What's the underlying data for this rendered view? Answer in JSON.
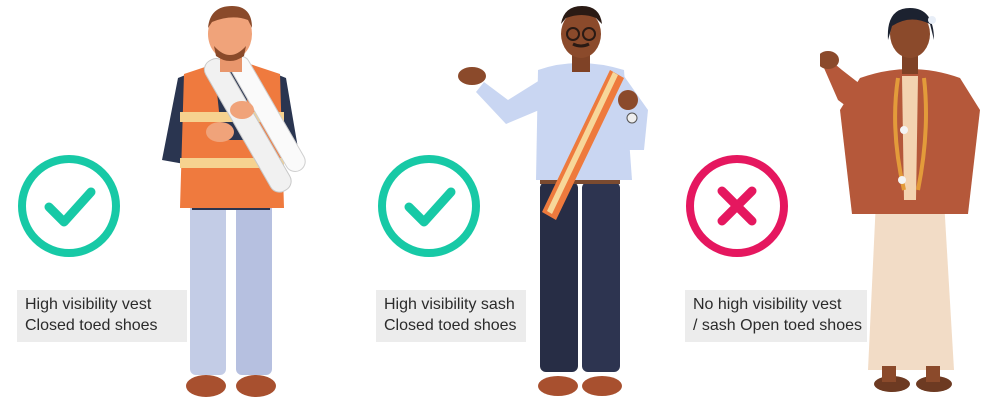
{
  "panels": [
    {
      "status": "approved",
      "icon": "check-circle-icon",
      "caption_line1": "High visibility vest",
      "caption_line2": "Closed toed shoes"
    },
    {
      "status": "approved",
      "icon": "check-circle-icon",
      "caption_line1": "High visibility sash",
      "caption_line2": "Closed toed shoes"
    },
    {
      "status": "not-approved",
      "icon": "x-circle-icon",
      "caption_line1": "No high visibility vest",
      "caption_line2": "/ sash Open toed shoes"
    }
  ],
  "colors": {
    "check": "#17c9a6",
    "cross": "#e5175f",
    "vest": "#ef7a3e",
    "sash": "#ee7a3d",
    "caption_bg": "#ececec"
  }
}
